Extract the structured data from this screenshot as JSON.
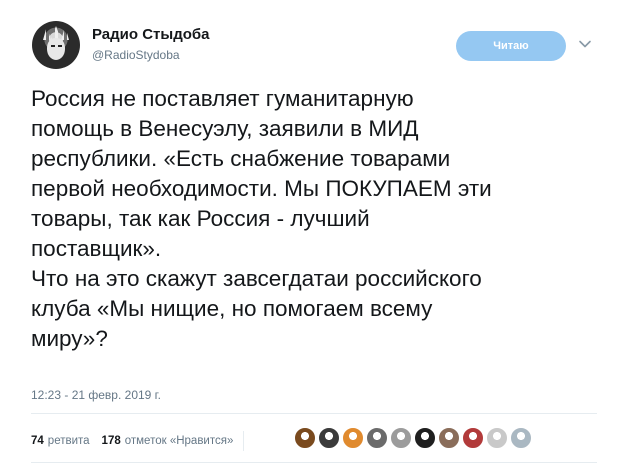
{
  "author": {
    "display_name": "Радио Стыдоба",
    "handle": "@RadioStydoba",
    "avatar_icon": "statue-of-liberty-avatar"
  },
  "follow_button": {
    "label": "Читаю",
    "color": "#95c8f2"
  },
  "tweet": {
    "text": "Россия не поставляет гуманитарную\nпомощь в Венесуэлу, заявили в МИД\nреспублики. «Есть снабжение товарами\nпервой необходимости. Мы ПОКУПАЕМ эти\nтовары, так как Россия - лучший\nпоставщик».\nЧто на это скажут завсегдатаи российского\nклуба «Мы нищие, но помогаем всему\nмиру»?",
    "timestamp": "12:23 - 21 февр. 2019 г."
  },
  "stats": {
    "retweets_count": "74",
    "retweets_label": "ретвита",
    "likes_count": "178",
    "likes_label": "отметок «Нравится»"
  },
  "likers": [
    {
      "name": "liker-avatar-1",
      "color": "#7a4a1e"
    },
    {
      "name": "liker-avatar-2",
      "color": "#3b3b3b"
    },
    {
      "name": "liker-avatar-3",
      "color": "#e08a2e"
    },
    {
      "name": "liker-avatar-4",
      "color": "#6b6b6b"
    },
    {
      "name": "liker-avatar-5",
      "color": "#9c9c9c"
    },
    {
      "name": "liker-avatar-6",
      "color": "#1f1f1f"
    },
    {
      "name": "liker-avatar-7",
      "color": "#8a6d5a"
    },
    {
      "name": "liker-avatar-8",
      "color": "#b23a3a"
    },
    {
      "name": "liker-avatar-9",
      "color": "#c9c9c9"
    },
    {
      "name": "liker-avatar-10",
      "color": "#aab8c2"
    }
  ]
}
